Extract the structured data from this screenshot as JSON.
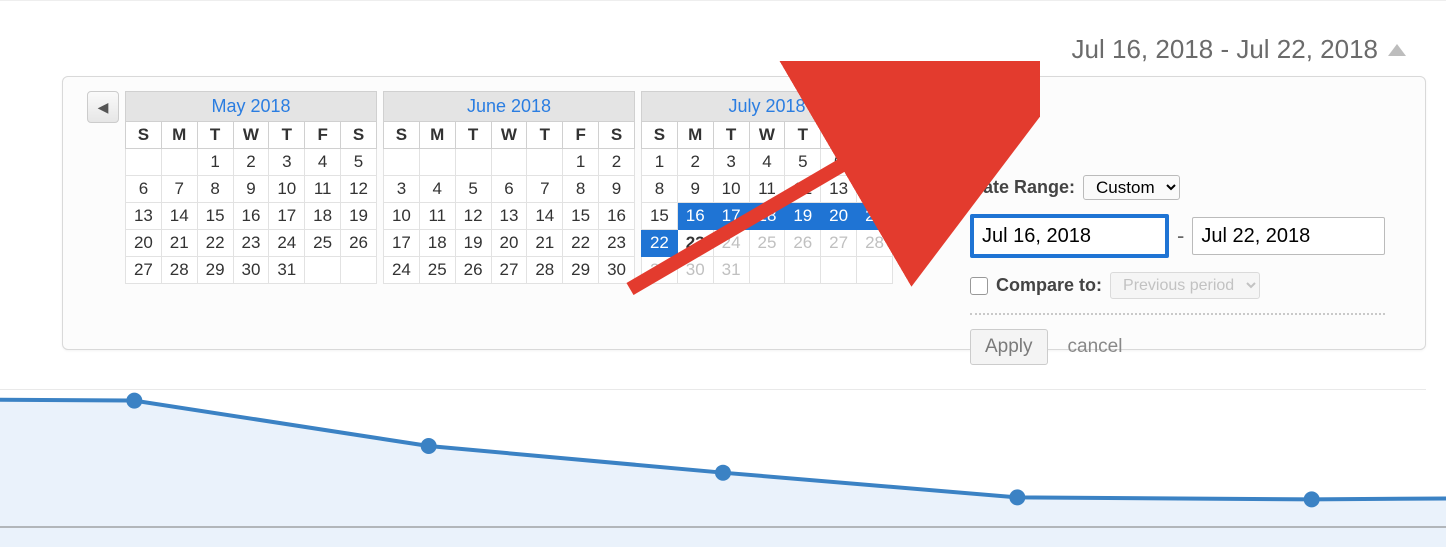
{
  "rangeDisplay": "Jul 16, 2018 - Jul 22, 2018",
  "weekdays": [
    "S",
    "M",
    "T",
    "W",
    "T",
    "F",
    "S"
  ],
  "months": [
    {
      "title": "May 2018",
      "firstDow": 2,
      "days": 31,
      "today": null,
      "maxDay": 31,
      "selStart": 0,
      "selEnd": 0
    },
    {
      "title": "June 2018",
      "firstDow": 5,
      "days": 30,
      "today": null,
      "maxDay": 30,
      "selStart": 0,
      "selEnd": 0
    },
    {
      "title": "July 2018",
      "firstDow": 0,
      "days": 31,
      "today": 23,
      "maxDay": 23,
      "selStart": 16,
      "selEnd": 22
    }
  ],
  "panel": {
    "dateRangeLabel": "Date Range:",
    "selectValue": "Custom",
    "from": "Jul 16, 2018",
    "to": "Jul 22, 2018",
    "compareLabel": "Compare to:",
    "compareValue": "Previous period",
    "applyLabel": "Apply",
    "cancelLabel": "cancel"
  },
  "chart_data": {
    "type": "line",
    "x": [
      0,
      1,
      2,
      3,
      4,
      5,
      6
    ],
    "values": [
      130,
      128,
      82,
      55,
      30,
      28,
      30
    ],
    "ylim": [
      0,
      160
    ]
  }
}
